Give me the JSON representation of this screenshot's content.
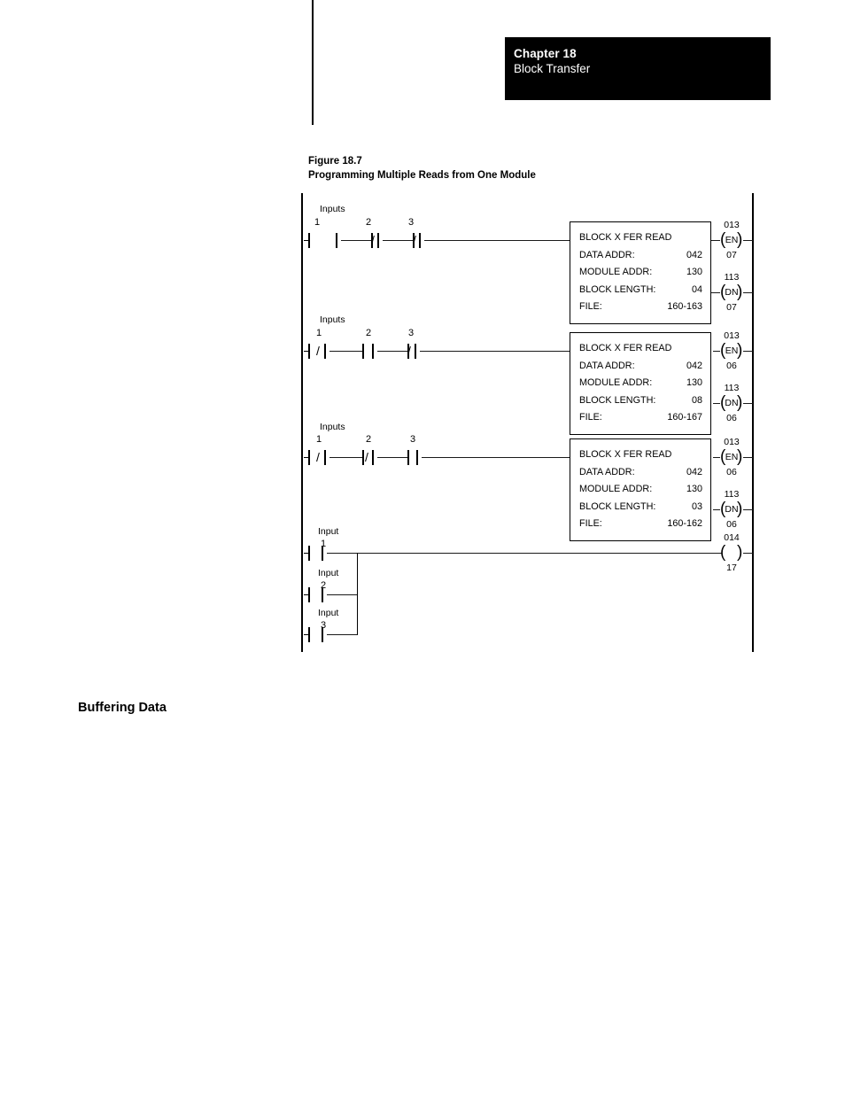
{
  "header": {
    "chapter": "Chapter 18",
    "title": "Block Transfer"
  },
  "figure": {
    "number": "Figure 18.7",
    "title": "Programming Multiple Reads from One Module"
  },
  "section_heading": "Buffering Data",
  "ladder": {
    "rungs": [
      {
        "group_label": "Inputs",
        "contacts": [
          {
            "label": "1",
            "type": "no"
          },
          {
            "label": "2",
            "type": "nc"
          },
          {
            "label": "3",
            "type": "nc"
          }
        ],
        "block": {
          "title": "BLOCK X FER READ",
          "rows": [
            {
              "label": "DATA ADDR:",
              "value": "042"
            },
            {
              "label": "MODULE ADDR:",
              "value": "130"
            },
            {
              "label": "BLOCK LENGTH:",
              "value": "04"
            },
            {
              "label": "FILE:",
              "value": "160-163"
            }
          ]
        },
        "coils": [
          {
            "name": "EN",
            "top": "013",
            "bottom": "07"
          },
          {
            "name": "DN",
            "top": "113",
            "bottom": "07"
          }
        ]
      },
      {
        "group_label": "Inputs",
        "contacts": [
          {
            "label": "1",
            "type": "nc"
          },
          {
            "label": "2",
            "type": "no"
          },
          {
            "label": "3",
            "type": "nc"
          }
        ],
        "block": {
          "title": "BLOCK X FER READ",
          "rows": [
            {
              "label": "DATA ADDR:",
              "value": "042"
            },
            {
              "label": "MODULE ADDR:",
              "value": "130"
            },
            {
              "label": "BLOCK LENGTH:",
              "value": "08"
            },
            {
              "label": "FILE:",
              "value": "160-167"
            }
          ]
        },
        "coils": [
          {
            "name": "EN",
            "top": "013",
            "bottom": "06"
          },
          {
            "name": "DN",
            "top": "113",
            "bottom": "06"
          }
        ]
      },
      {
        "group_label": "Inputs",
        "contacts": [
          {
            "label": "1",
            "type": "nc"
          },
          {
            "label": "2",
            "type": "nc"
          },
          {
            "label": "3",
            "type": "no"
          }
        ],
        "block": {
          "title": "BLOCK X FER READ",
          "rows": [
            {
              "label": "DATA ADDR:",
              "value": "042"
            },
            {
              "label": "MODULE ADDR:",
              "value": "130"
            },
            {
              "label": "BLOCK LENGTH:",
              "value": "03"
            },
            {
              "label": "FILE:",
              "value": "160-162"
            }
          ]
        },
        "coils": [
          {
            "name": "EN",
            "top": "013",
            "bottom": "06"
          },
          {
            "name": "DN",
            "top": "113",
            "bottom": "06"
          }
        ]
      }
    ],
    "branch_rung": {
      "branches": [
        {
          "group_label": "Input",
          "label": "1",
          "type": "no"
        },
        {
          "group_label": "Input",
          "label": "2",
          "type": "no"
        },
        {
          "group_label": "Input",
          "label": "3",
          "type": "no"
        }
      ],
      "coil": {
        "name": "",
        "top": "014",
        "bottom": "17"
      }
    }
  }
}
